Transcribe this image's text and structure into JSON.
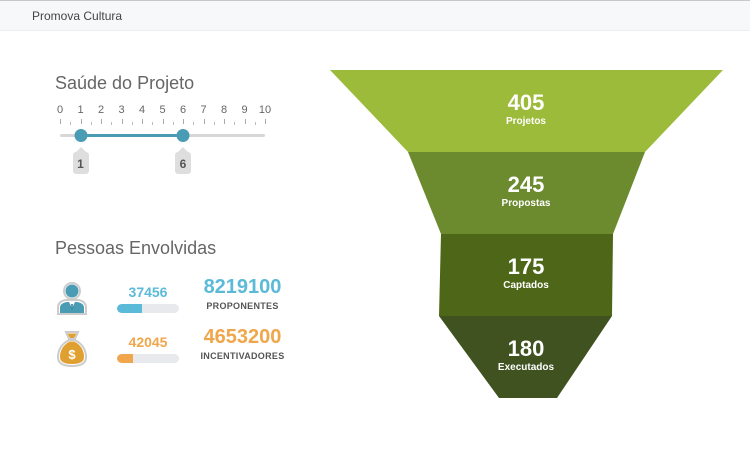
{
  "app": {
    "title": "Promova Cultura"
  },
  "health": {
    "title": "Saúde do Projeto",
    "scale": {
      "min": 0,
      "max": 10,
      "labels": [
        "0",
        "1",
        "2",
        "3",
        "4",
        "5",
        "6",
        "7",
        "8",
        "9",
        "10"
      ]
    },
    "range": {
      "low": 1,
      "high": 6,
      "low_label": "1",
      "high_label": "6"
    },
    "color": "#4a9cb5"
  },
  "people": {
    "title": "Pessoas Envolvidas",
    "rows": [
      {
        "icon": "user-icon",
        "small_count": "37456",
        "progress": 0.4,
        "big_count": "8219100",
        "label": "PROPONENTES",
        "color": "#5bbad8"
      },
      {
        "icon": "money-bag-icon",
        "small_count": "42045",
        "progress": 0.25,
        "big_count": "4653200",
        "label": "INCENTIVADORES",
        "color": "#f0a64a"
      }
    ]
  },
  "funnel": {
    "stages": [
      {
        "value": "405",
        "label": "Projetos",
        "color": "#9dbb3a"
      },
      {
        "value": "245",
        "label": "Propostas",
        "color": "#6c8a2e"
      },
      {
        "value": "175",
        "label": "Captados",
        "color": "#4d6618"
      },
      {
        "value": "180",
        "label": "Executados",
        "color": "#3f5220"
      }
    ]
  }
}
